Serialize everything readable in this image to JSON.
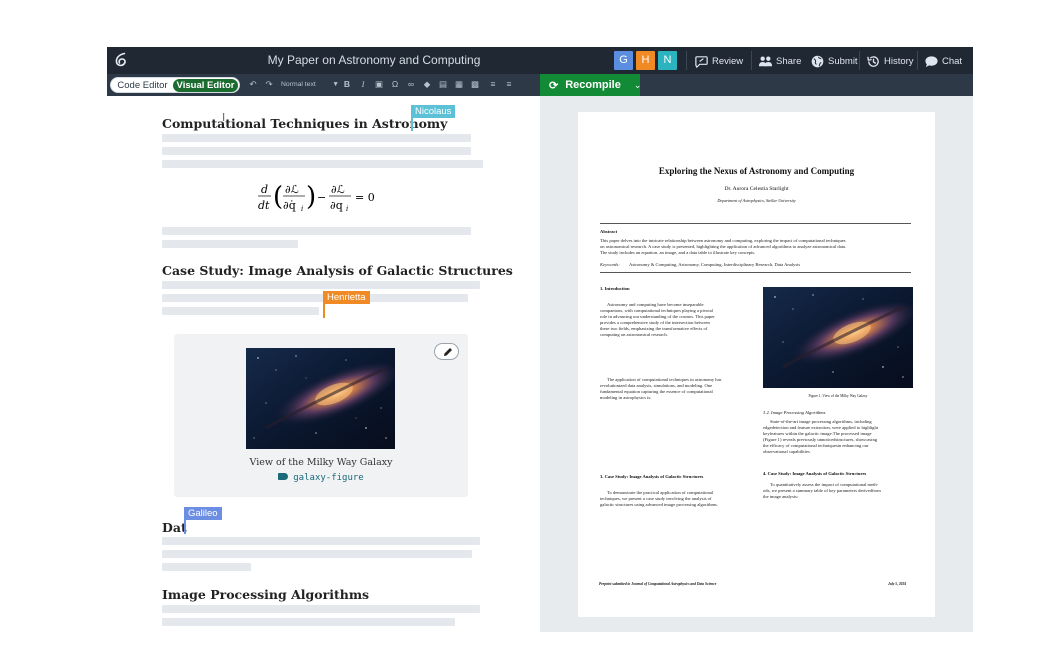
{
  "window": {
    "title": "My Paper on Astronomy and Computing",
    "collaborators": [
      {
        "initial": "G",
        "color": "#5b8de0"
      },
      {
        "initial": "H",
        "color": "#f08a24"
      },
      {
        "initial": "N",
        "color": "#2bb3c0"
      }
    ],
    "actions": {
      "review": "Review",
      "share": "Share",
      "submit": "Submit",
      "history": "History",
      "chat": "Chat"
    }
  },
  "toolbar": {
    "code_editor": "Code Editor",
    "visual_editor": "Visual Editor",
    "text_style": "Normal text",
    "recompile": "Recompile"
  },
  "editor": {
    "heading1": "Computational Techniques in Astronomy",
    "heading2": "Case Study: Image Analysis of Galactic Structures",
    "heading3_partial": "Dat",
    "heading4": "Image Processing Algorithms",
    "cursors": {
      "nicolaus": {
        "name": "Nicolaus",
        "color": "#5cc1d6"
      },
      "henrietta": {
        "name": "Henrietta",
        "color": "#f08a24"
      },
      "galileo": {
        "name": "Galileo",
        "color": "#6b8ee3"
      }
    },
    "figure": {
      "caption": "View of the Milky Way Galaxy",
      "label": "galaxy-figure"
    }
  },
  "preview": {
    "title": "Exploring the Nexus of Astronomy and Computing",
    "author": "Dr. Aurora Celestia Starlight",
    "affiliation": "Department of Astrophysics, Stellar University",
    "abstract_heading": "Abstract",
    "abstract_lines": [
      "This paper delves into the intricate relationship between astronomy and computing, exploring the impact of computational techniques",
      "on astronomical research. A case study is presented, highlighting the application of advanced algorithms to analyze astronomical data.",
      "The study includes an equation, an image, and a data table to illustrate key concepts."
    ],
    "keywords_label": "Keywords:",
    "keywords": "Astronomy & Computing, Astronomy, Computing, Interdisciplinary Research, Data Analysis",
    "intro_heading": "1. Introduction",
    "intro_lines": [
      "Astronomy and computing have become inseparable",
      "companions, with computational techniques playing a pivotal",
      "role in advancing our understanding of the cosmos. This paper",
      "provides a comprehensive study of the intersection between",
      "these two fields, emphasizing the transformative effects of",
      "computing on astronomical research."
    ],
    "application_lines": [
      "The application of computational techniques in astronomy has",
      "revolutionized data analysis, simulations, and modeling. One",
      "fundamental equation capturing the essence of computational",
      "modeling in astrophysics is:"
    ],
    "figure_caption": "Figure 1: View of the Milky Way Galaxy",
    "sub_heading": "3.2.  Image Processing Algorithms",
    "sub_lines": [
      "State-of-the-art image processing algorithms, including",
      "edgedetection and feature extraction, were applied to highlight",
      "keyfeatures within the galactic image.The processed image",
      "(Figure 1) reveals previously unnoticedstructures, showcasing",
      "the efficacy of computational techniquesin enhancing our",
      "observational capabilities"
    ],
    "case_heading": "3. Case Study: Image Analysis of Galactic Structures",
    "case_lines": [
      "To demonstrate the practical application of computational",
      "techniques, we present a case study involving the analysis of",
      "galactic structures using advanced image processing algorithms."
    ],
    "case4_heading": "4. Case Study: Image Analysis of Galactic Structures",
    "case4_lines": [
      "To quantitatively assess the impact of computational meth-",
      "ods, we present a summary table of key parameters derivedfrom",
      "the image analysis:"
    ],
    "footer_left": "Preprint submitted to Journal of Computational Astrophysics and Data Science",
    "footer_right": "July 5, 2024"
  }
}
